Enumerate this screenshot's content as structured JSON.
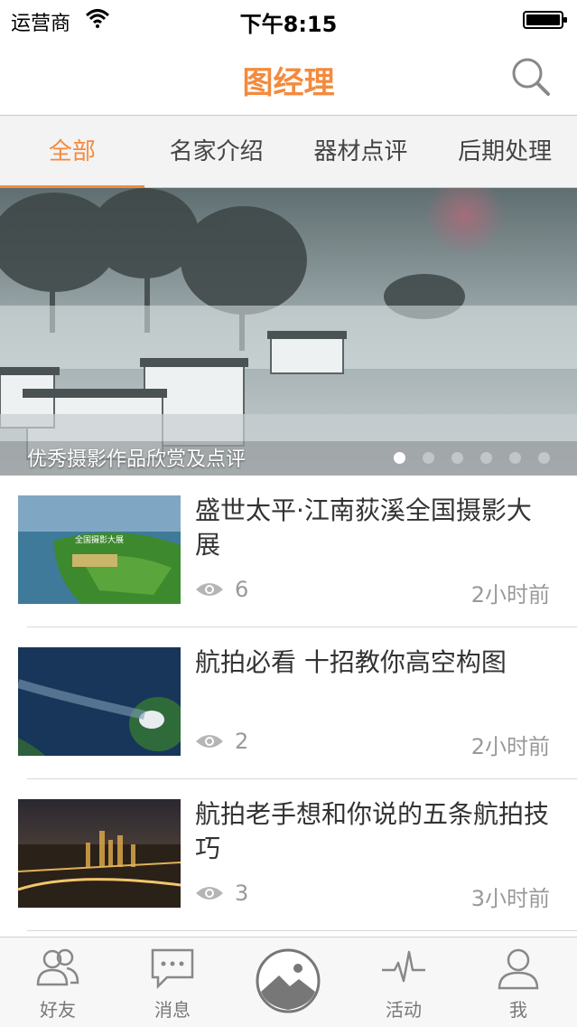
{
  "status_bar": {
    "carrier": "运营商",
    "time": "下午8:15"
  },
  "nav": {
    "title": "图经理",
    "search_icon": "search-icon"
  },
  "tabs": [
    {
      "label": "全部",
      "active": true
    },
    {
      "label": "名家介绍",
      "active": false
    },
    {
      "label": "器材点评",
      "active": false
    },
    {
      "label": "后期处理",
      "active": false
    }
  ],
  "banner": {
    "caption": "优秀摄影作品欣赏及点评",
    "slide_count": 6,
    "active_slide": 1
  },
  "articles": [
    {
      "title": "盛世太平·江南荻溪全国摄影大展",
      "views": "6",
      "time": "2小时前",
      "thumb_caption": "全国摄影大展"
    },
    {
      "title": "航拍必看 十招教你高空构图",
      "views": "2",
      "time": "2小时前"
    },
    {
      "title": "航拍老手想和你说的五条航拍技巧",
      "views": "3",
      "time": "3小时前"
    }
  ],
  "tab_bar": {
    "items": [
      {
        "label": "好友",
        "icon": "friends-icon"
      },
      {
        "label": "消息",
        "icon": "message-icon"
      },
      {
        "label": "",
        "icon": "camera-gallery-icon"
      },
      {
        "label": "活动",
        "icon": "activity-icon"
      },
      {
        "label": "我",
        "icon": "profile-icon"
      }
    ]
  },
  "colors": {
    "accent": "#f48a3c",
    "text": "#333333",
    "muted": "#999999"
  }
}
